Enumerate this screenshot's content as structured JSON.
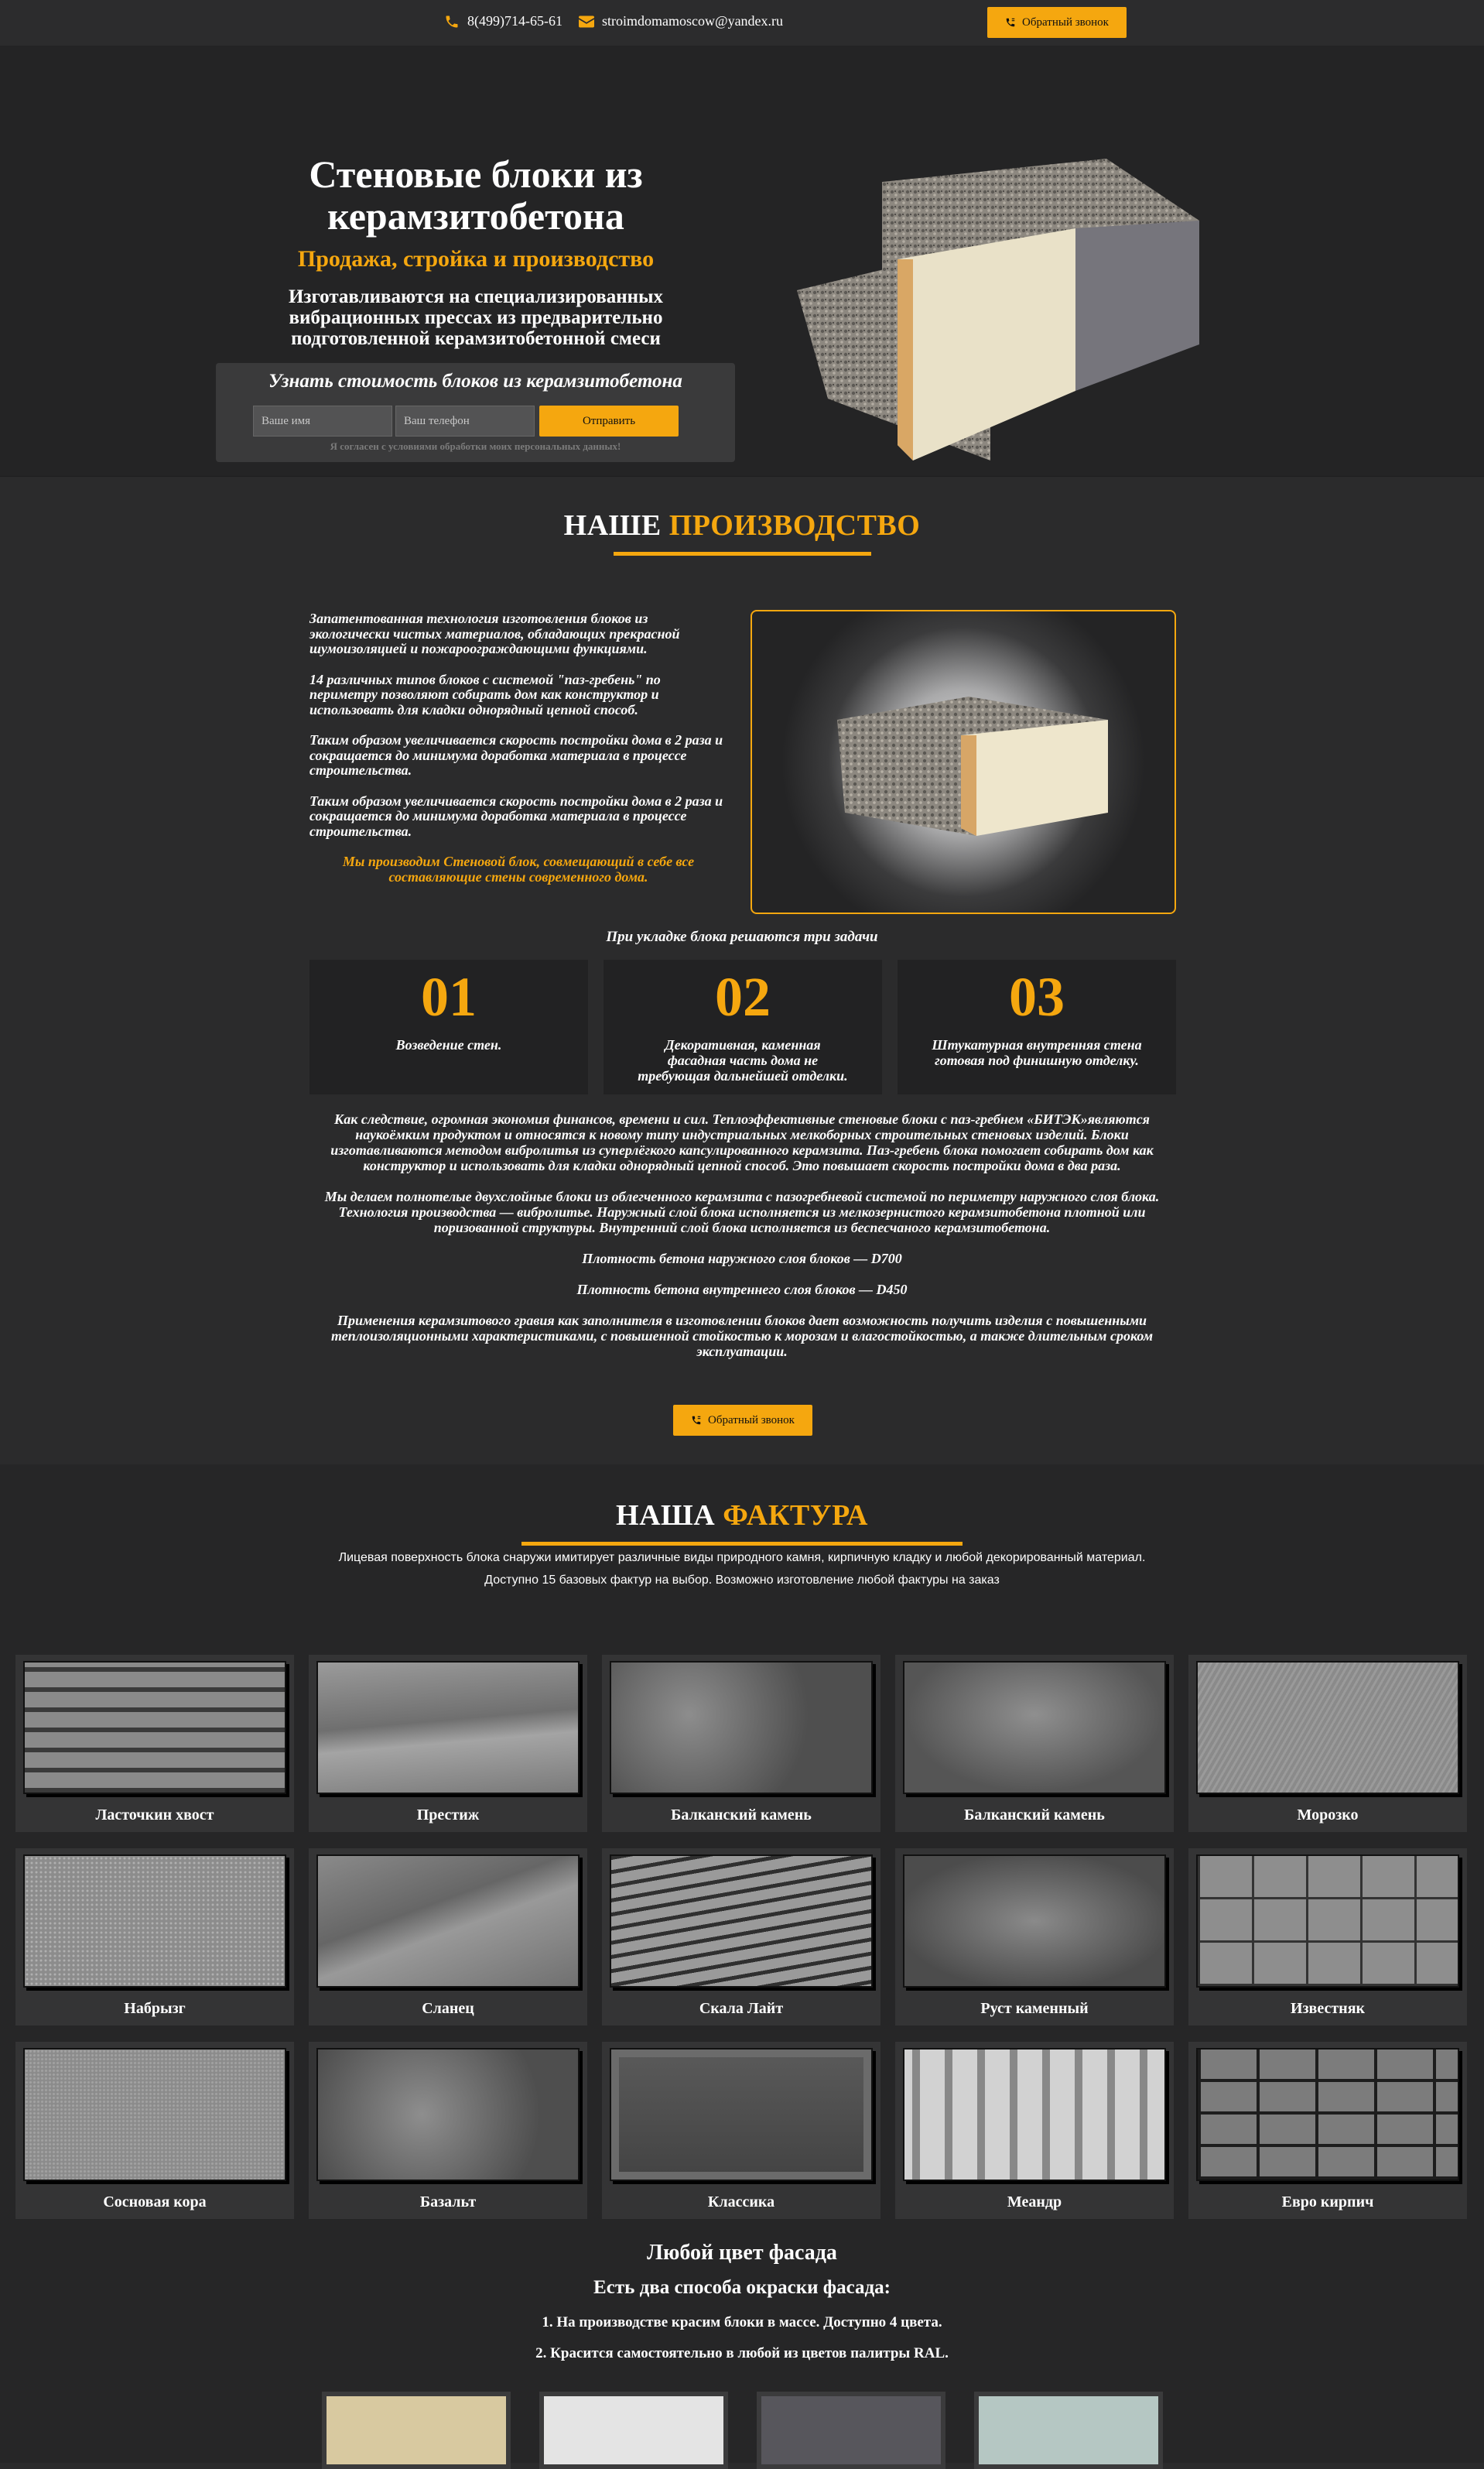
{
  "header": {
    "phone": "8(499)714-65-61",
    "email": "stroimdomamoscow@yandex.ru",
    "callback_label": "Обратный звонок"
  },
  "hero": {
    "title": "Стеновые блоки из керамзитобетона",
    "subtitle": "Продажа, стройка и производство",
    "description": "Изготавливаются на специализированных вибрационных прессах из предварительно подготовленной керамзитобетонной смеси",
    "form": {
      "title": "Узнать стоимость блоков из керамзитобетона",
      "name_placeholder": "Ваше имя",
      "phone_placeholder": "Ваш телефон",
      "submit_label": "Отправить",
      "agreement": "Я согласен с условиями обработки моих персональных данных!"
    }
  },
  "production": {
    "title_white": "НАШЕ",
    "title_accent": "ПРОИЗВОДСТВО",
    "paragraphs": [
      "Запатентованная технология изготовления блоков из экологически чистых материалов, обладающих прекрасной шумоизоляцией и пожароограждающими функциями.",
      "14 различных типов блоков с системой \"паз-гребень\" по периметру позволяют собирать дом как конструктор и использовать для кладки однорядный цепной способ.",
      "Таким образом увеличивается скорость постройки дома в 2 раза и сокращается до минимума доработка материала в процессе строительства.",
      "Таким образом увеличивается скорость постройки дома в 2 раза и сокращается до минимума доработка материала в процессе строительства."
    ],
    "highlight": "Мы производим Стеновой блок, совмещающий в себе все составляющие стены современного дома.",
    "tasks_title": "При укладке блока решаются три задачи",
    "tasks": [
      {
        "num": "01",
        "text": "Возведение стен."
      },
      {
        "num": "02",
        "text": "Декоративная, каменная фасадная часть дома не требующая дальнейшей отделки."
      },
      {
        "num": "03",
        "text": "Штукатурная внутренняя стена готовая под финишную отделку."
      }
    ],
    "desc": [
      "Как следствие, огромная экономия финансов, времени и сил. Теплоэффективные стеновые блоки с паз-гребнем «БИТЭК»являются наукоёмким продуктом и относятся к новому типу индустриальных мелкоборных строительных стеновых изделий. Блоки изготавливаются методом вибролитья из суперлёгкого капсулированного керамзита. Паз-гребень блока помогает собирать дом как конструктор и использовать для кладки однорядный цепной способ. Это повышает скорость постройки дома в два раза.",
      "Мы делаем полнотелые двухслойные блоки из облегченного керамзита с пазогребневой системой по периметру наружного слоя блока. Технология производства — вибролитье. Наружный слой блока исполняется из мелкозернистого керамзитобетона плотной или поризованной структуры. Внутренний слой блока исполняется из беспесчаного керамзитобетона.",
      "Плотность бетона наружного слоя блоков — D700",
      "Плотность бетона внутреннего слоя блоков — D450",
      "Применения керамзитового гравия как заполнителя в изготовлении блоков дает возможность получить изделия с повышенными теплоизоляционными характеристиками, с повышенной стойкостью к морозам и влагостойкостью, а также длительным сроком эксплуатации."
    ],
    "callback_label": "Обратный звонок"
  },
  "texture": {
    "title_white": "НАША",
    "title_accent": "ФАКТУРА",
    "line1": "Лицевая поверхность блока снаружи имитирует различные виды природного камня, кирпичную кладку и любой декорированный материал.",
    "line2": "Доступно 15 базовых фактур на выбор. Возможно изготовление любой фактуры на заказ",
    "items": [
      "Ласточкин хвост",
      "Престиж",
      "Балканский камень",
      "Балканский камень",
      "Морозко",
      "Набрызг",
      "Сланец",
      "Скала Лайт",
      "Руст каменный",
      "Известняк",
      "Сосновая кора",
      "Базальт",
      "Классика",
      "Меандр",
      "Евро кирпич"
    ]
  },
  "facade": {
    "title": "Любой цвет фасада",
    "subtitle": "Есть два способа окраски фасада:",
    "item1": "1. На производстве красим блоки в массе. Доступно 4 цвета.",
    "item2": "2. Красится самостоятельно в любой из цветов палитры RAL."
  },
  "colors": {
    "accent": "#f5a70f",
    "swatches": [
      "#d8c9a0",
      "#e4e4e4",
      "#57565c",
      "#b5c7c3"
    ]
  }
}
